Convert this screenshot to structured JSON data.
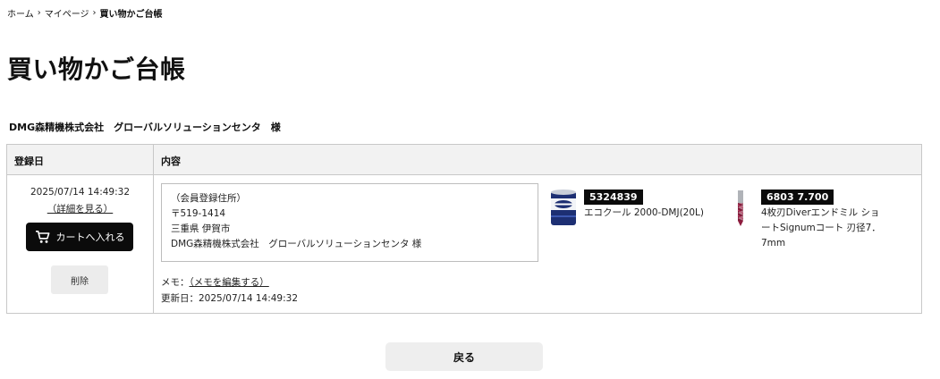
{
  "breadcrumb": {
    "home": "ホーム",
    "mypage": "マイページ",
    "current": "買い物かご台帳"
  },
  "page_title": "買い物かご台帳",
  "company_line": "DMG森精機株式会社　グローバルソリューションセンタ　様",
  "table": {
    "headers": {
      "date": "登録日",
      "content": "内容"
    },
    "row": {
      "registered_at": "2025/07/14 14:49:32",
      "detail_link": "（詳細を見る）",
      "cart_button": "カートへ入れる",
      "delete_button": "削除",
      "address": [
        "（会員登録住所）",
        "〒519-1414",
        "三重県 伊賀市",
        "DMG森精機株式会社　グローバルソリューションセンタ 様"
      ],
      "memo_label": "メモ：",
      "memo_link": "（メモを編集する）",
      "updated_label": "更新日：",
      "updated_at": "2025/07/14 14:49:32",
      "products": [
        {
          "code": "5324839",
          "name": "エコクール 2000-DMJ(20L)",
          "thumb_icon": "coolant-can-icon"
        },
        {
          "code": "6803 7.700",
          "name": "4枚刃Diverエンドミル ショートSignumコート 刃径7．7mm",
          "thumb_icon": "end-mill-icon"
        }
      ]
    }
  },
  "back_button": "戻る",
  "colors": {
    "header_bg": "#f2f2f2",
    "border": "#c8c8c8",
    "cart_button_bg": "#0b0b0b",
    "code_badge_bg": "#0b0b0b",
    "secondary_button_bg": "#eeeeee"
  }
}
